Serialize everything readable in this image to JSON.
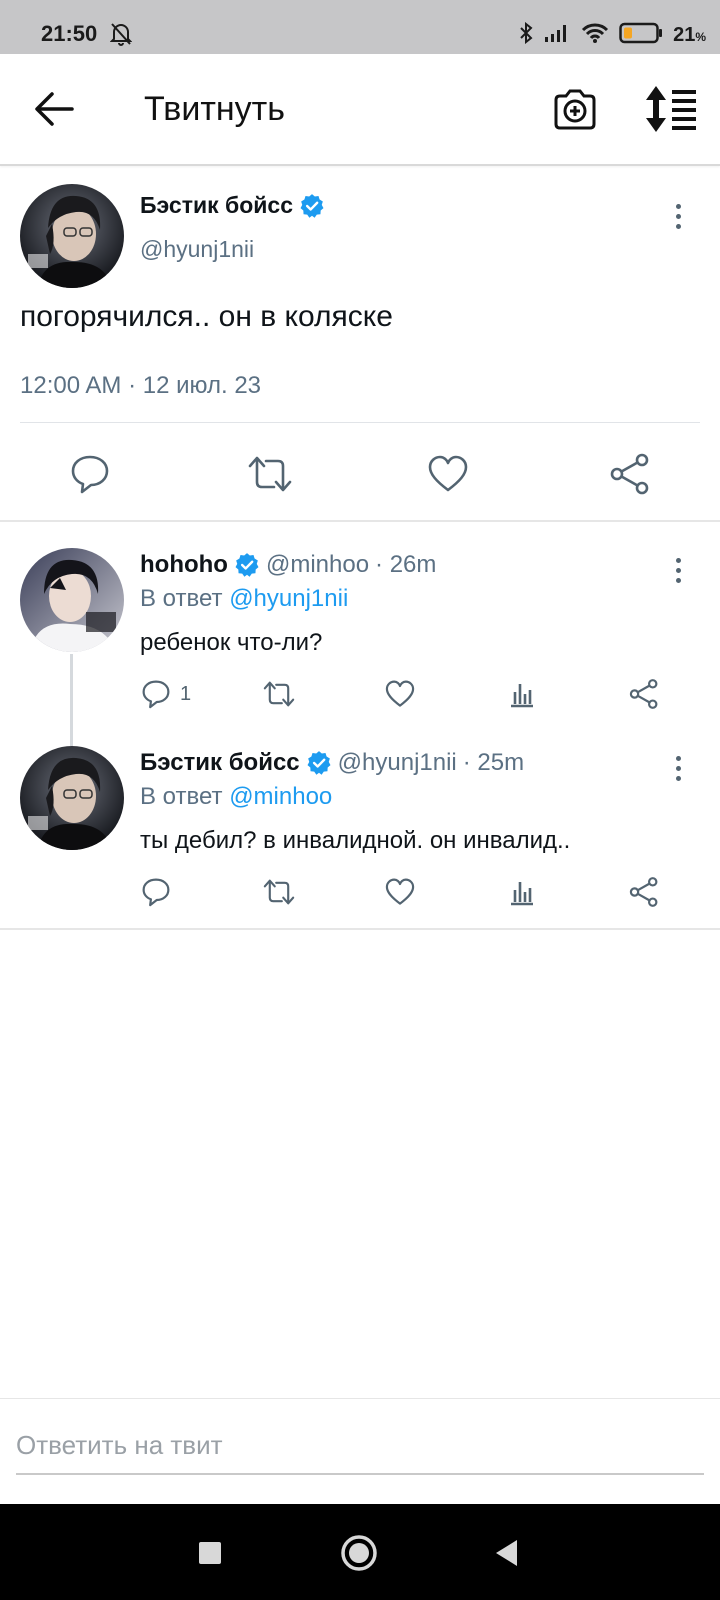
{
  "status_bar": {
    "time": "21:50",
    "battery_percent": "21",
    "battery_unit": "%",
    "battery_color": "#f5a623"
  },
  "app_bar": {
    "title": "Твитнуть"
  },
  "main_tweet": {
    "author_name": "Бэстик бойсс",
    "handle": "@hyunj1nii",
    "text": "погорячился.. он в коляске",
    "timestamp": "12:00 AM · 12 июл. 23"
  },
  "replies": [
    {
      "author_name": "hohoho",
      "handle": "@minhoo",
      "age": "· 26m",
      "reply_prefix": "В ответ",
      "reply_to": "@hyunj1nii",
      "text": "ребенок что-ли?",
      "reply_count": "1"
    },
    {
      "author_name": "Бэстик бойсс",
      "handle": "@hyunj1nii",
      "age": "· 25m",
      "reply_prefix": "В ответ",
      "reply_to": "@minhoo",
      "text": "ты дебил? в инвалидной. он инвалид..",
      "reply_count": ""
    }
  ],
  "composer": {
    "placeholder": "Ответить на твит"
  },
  "colors": {
    "accent": "#1d9bf0",
    "verified": "#1d9bf0",
    "secondary_text": "#5b7083"
  }
}
